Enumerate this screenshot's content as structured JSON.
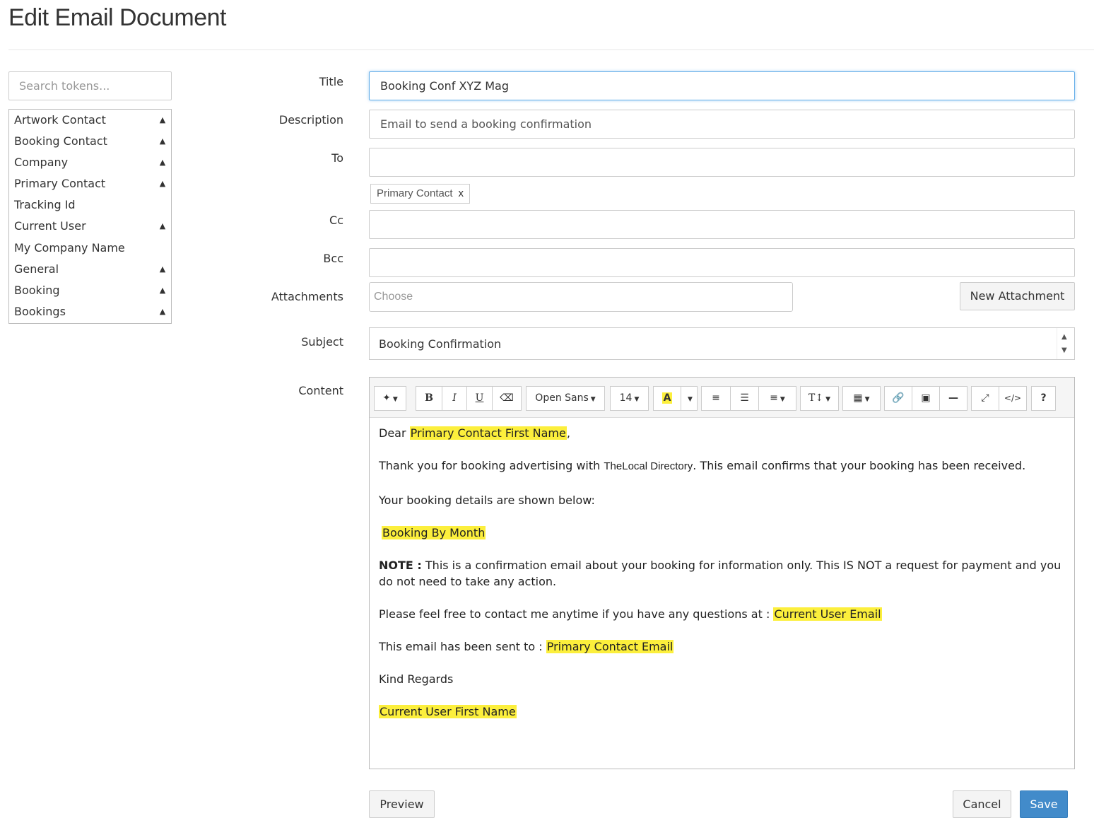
{
  "page": {
    "title": "Edit Email Document"
  },
  "sidebar": {
    "search_placeholder": "Search tokens...",
    "tokens": [
      {
        "label": "Artwork Contact",
        "expandable": true
      },
      {
        "label": "Booking Contact",
        "expandable": true
      },
      {
        "label": "Company",
        "expandable": true
      },
      {
        "label": "Primary Contact",
        "expandable": true
      },
      {
        "label": "Tracking Id",
        "expandable": false
      },
      {
        "label": "Current User",
        "expandable": true
      },
      {
        "label": "My Company Name",
        "expandable": false
      },
      {
        "label": "General",
        "expandable": true
      },
      {
        "label": "Booking",
        "expandable": true
      },
      {
        "label": "Bookings",
        "expandable": true
      }
    ]
  },
  "form": {
    "labels": {
      "title": "Title",
      "description": "Description",
      "to": "To",
      "cc": "Cc",
      "bcc": "Bcc",
      "attachments": "Attachments",
      "subject": "Subject",
      "content": "Content"
    },
    "title_value": "Booking Conf XYZ Mag",
    "description_value": "Email to send a booking confirmation",
    "to_value": "",
    "to_chips": [
      "Primary Contact"
    ],
    "chip_remove": "x",
    "cc_value": "",
    "bcc_value": "",
    "attachments_placeholder": "Choose",
    "new_attachment_label": "New Attachment",
    "subject_value": "Booking Confirmation"
  },
  "toolbar": {
    "font_family": "Open Sans",
    "font_size": "14",
    "icons": [
      "magic-icon",
      "bold-icon",
      "italic-icon",
      "underline-icon",
      "eraser-icon",
      "highlight-icon",
      "unordered-list-icon",
      "ordered-list-icon",
      "align-icon",
      "text-height-icon",
      "table-icon",
      "link-icon",
      "picture-icon",
      "horizontal-rule-icon",
      "fullscreen-icon",
      "code-view-icon",
      "help-icon"
    ],
    "highlight_color": "#fcef3c"
  },
  "content": {
    "greeting_prefix": "Dear ",
    "greeting_token": "Primary Contact First Name",
    "greeting_suffix": ",",
    "thanks_a": "Thank you for booking advertising with ",
    "thanks_company": "TheLocal Directory",
    "thanks_b": ". This email confirms that your booking has been received.",
    "details_intro": "Your booking details are shown below:",
    "booking_token": "Booking By Month",
    "note_label": "NOTE :",
    "note_text": " This is a confirmation email about your booking for information only. This IS NOT a request for payment and you do not need to take any action.",
    "contact_text": "Please feel free to contact me anytime if you have any questions at : ",
    "contact_token": "Current User Email",
    "sent_text": "This email has been sent to : ",
    "sent_token": "Primary Contact Email",
    "regards": "Kind Regards",
    "signature_token": "Current User First Name"
  },
  "actions": {
    "preview": "Preview",
    "cancel": "Cancel",
    "save": "Save"
  },
  "colors": {
    "primary": "#428bca",
    "focus_border": "#66afe9",
    "token_highlight": "#fcef3c"
  }
}
